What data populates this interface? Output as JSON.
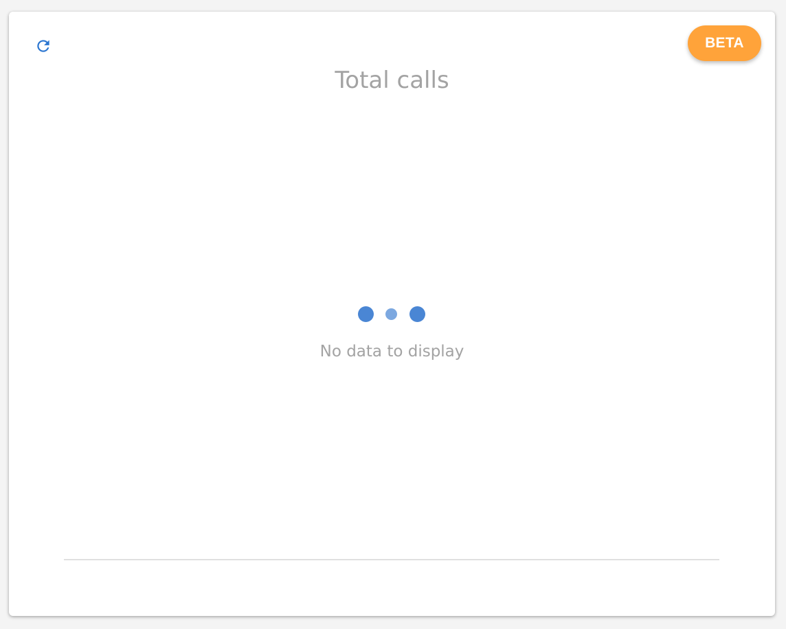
{
  "widget": {
    "title": "Total calls",
    "badge": "BETA",
    "empty_message": "No data to display",
    "refresh_icon": "refresh-icon"
  },
  "colors": {
    "accent": "#4a86d4",
    "refresh": "#2a75d0",
    "badge_bg": "#ffa33a",
    "muted_text": "#a3a3a3"
  }
}
